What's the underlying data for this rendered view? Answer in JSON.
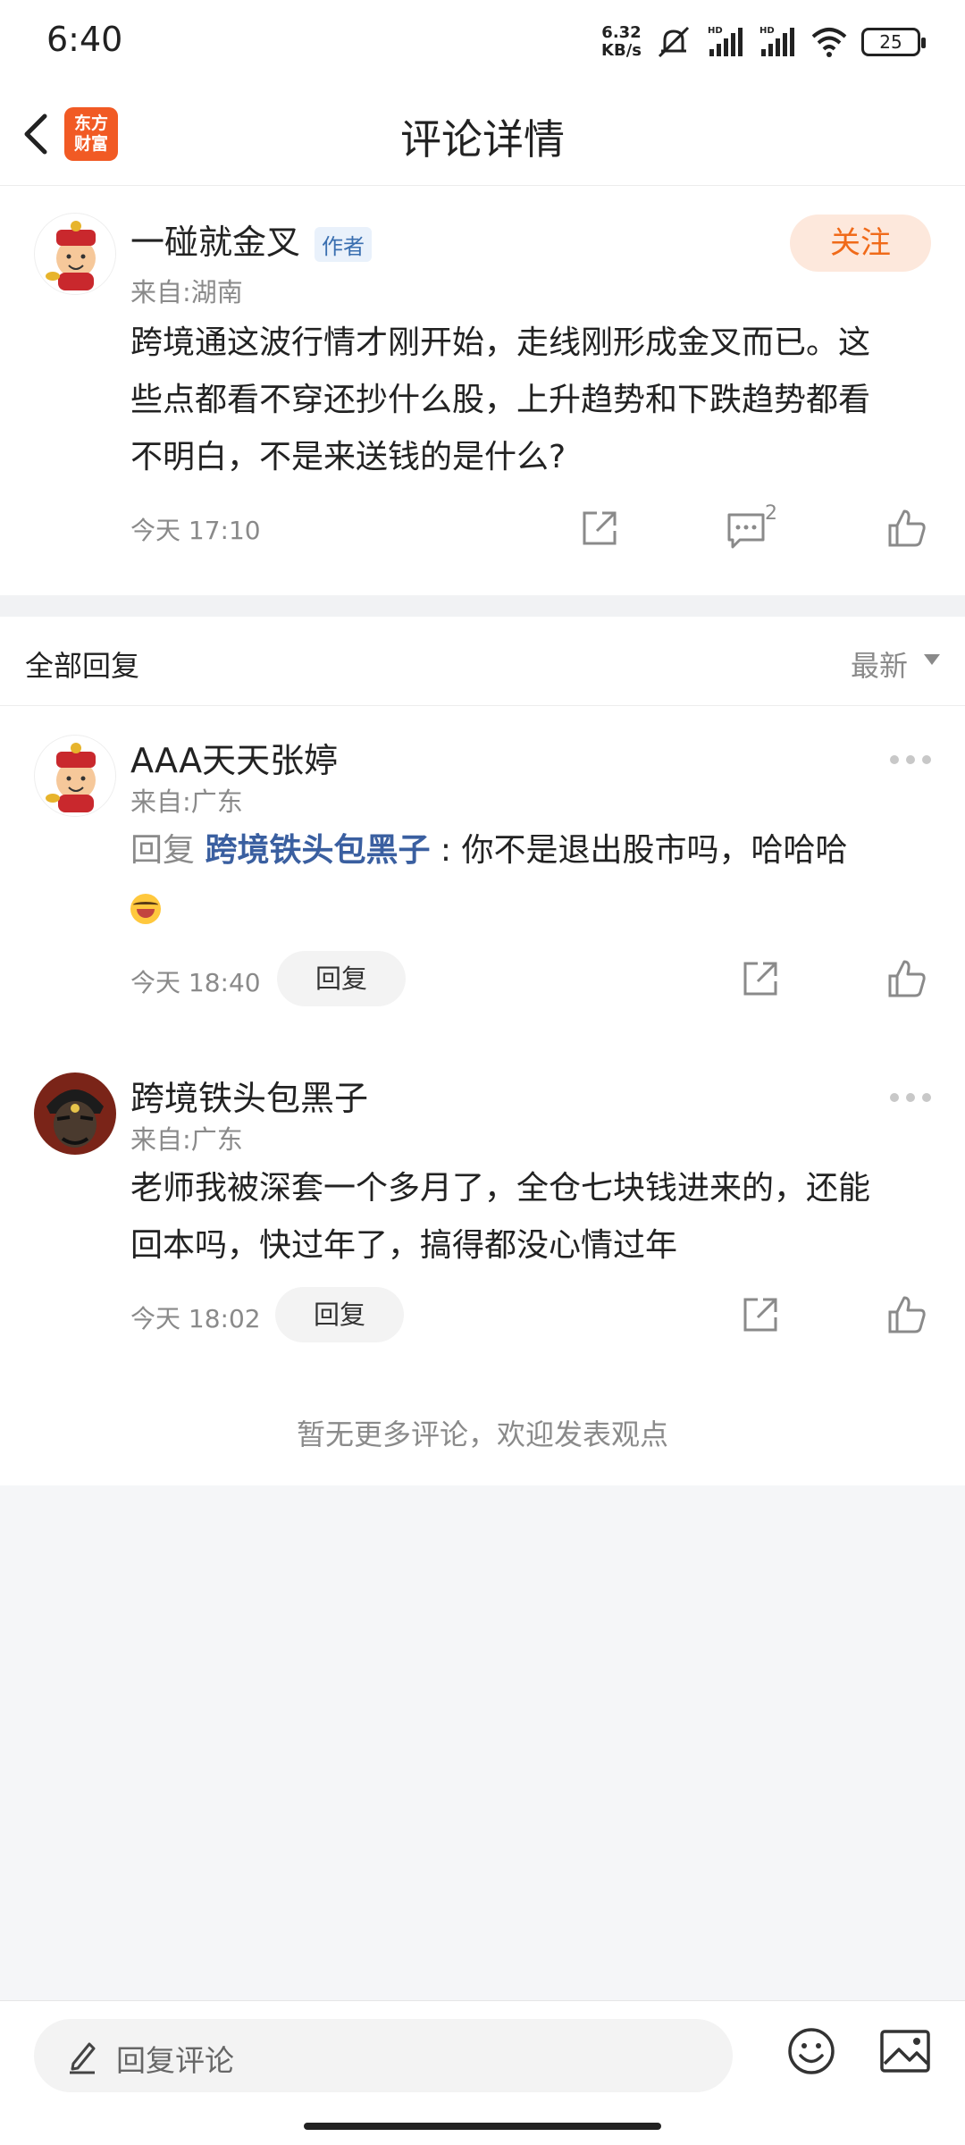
{
  "status_bar": {
    "time": "6:40",
    "net_speed_value": "6.32",
    "net_speed_unit": "KB/s",
    "battery": "25"
  },
  "nav": {
    "title": "评论详情",
    "logo_line1": "东方",
    "logo_line2": "财富"
  },
  "main_comment": {
    "username": "一碰就金叉",
    "author_tag": "作者",
    "location": "来自:湖南",
    "follow_label": "关注",
    "content_line1": "跨境通这波行情才刚开始，走线刚形成金叉而已。这",
    "content_line2": "些点都看不穿还抄什么股，上升趋势和下跌趋势都看",
    "content_line3": "不明白，不是来送钱的是什么?",
    "time": "今天 17:10",
    "comment_count": "2"
  },
  "replies_header": {
    "title": "全部回复",
    "sort_label": "最新"
  },
  "replies": [
    {
      "username": "AAA天天张婷",
      "location": "来自:广东",
      "reply_prefix": "回复 ",
      "reply_target": "跨境铁头包黑子",
      "content": " : 你不是退出股市吗，哈哈哈",
      "time": "今天 18:40",
      "reply_label": "回复"
    },
    {
      "username": "跨境铁头包黑子",
      "location": "来自:广东",
      "content_line1": "老师我被深套一个多月了，全仓七块钱进来的，还能",
      "content_line2": "回本吗，快过年了，搞得都没心情过年",
      "time": "今天 18:02",
      "reply_label": "回复"
    }
  ],
  "no_more_text": "暂无更多评论，欢迎发表观点",
  "bottom_bar": {
    "input_placeholder": "回复评论"
  },
  "colors": {
    "accent_orange": "#f06a19",
    "follow_bg": "#fde8dc",
    "link_blue": "#3a5fa0",
    "logo_orange": "#f15a24"
  }
}
